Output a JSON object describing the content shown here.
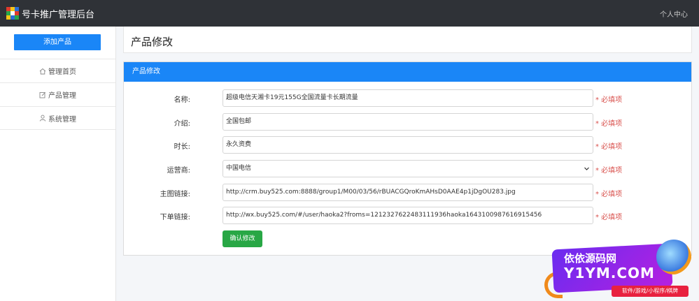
{
  "header": {
    "brand": "号卡推广管理后台",
    "user_center": "个人中心"
  },
  "sidebar": {
    "add_button": "添加产品",
    "items": [
      {
        "label": "管理首页",
        "icon": "home-icon"
      },
      {
        "label": "产品管理",
        "icon": "edit-icon"
      },
      {
        "label": "系统管理",
        "icon": "user-icon"
      }
    ]
  },
  "page": {
    "title": "产品修改"
  },
  "form": {
    "card_title": "产品修改",
    "required_text": "* 必填项",
    "fields": [
      {
        "label": "名称:",
        "value": "超级电信天湘卡19元155G全国流量卡长期流量"
      },
      {
        "label": "介绍:",
        "value": "全国包邮"
      },
      {
        "label": "时长:",
        "value": "永久资费"
      },
      {
        "label": "运营商:",
        "value": "中国电信"
      },
      {
        "label": "主图链接:",
        "value": "http://crm.buy525.com:8888/group1/M00/03/56/rBUACGQroKmAHsD0AAE4p1jDgOU283.jpg"
      },
      {
        "label": "下单链接:",
        "value": "http://wx.buy525.com/#/user/haoka2?froms=1212327622483111936haoka1643100987616915456"
      }
    ],
    "submit": "确认修改"
  },
  "watermark": {
    "line1": "依依源码网",
    "line2": "Y1YM.COM",
    "tagline": "软件/游戏/小程序/棋牌"
  },
  "colors": {
    "topbar": "#2f3237",
    "primary": "#1a86f7",
    "success": "#28a745",
    "required": "#d9534f"
  }
}
